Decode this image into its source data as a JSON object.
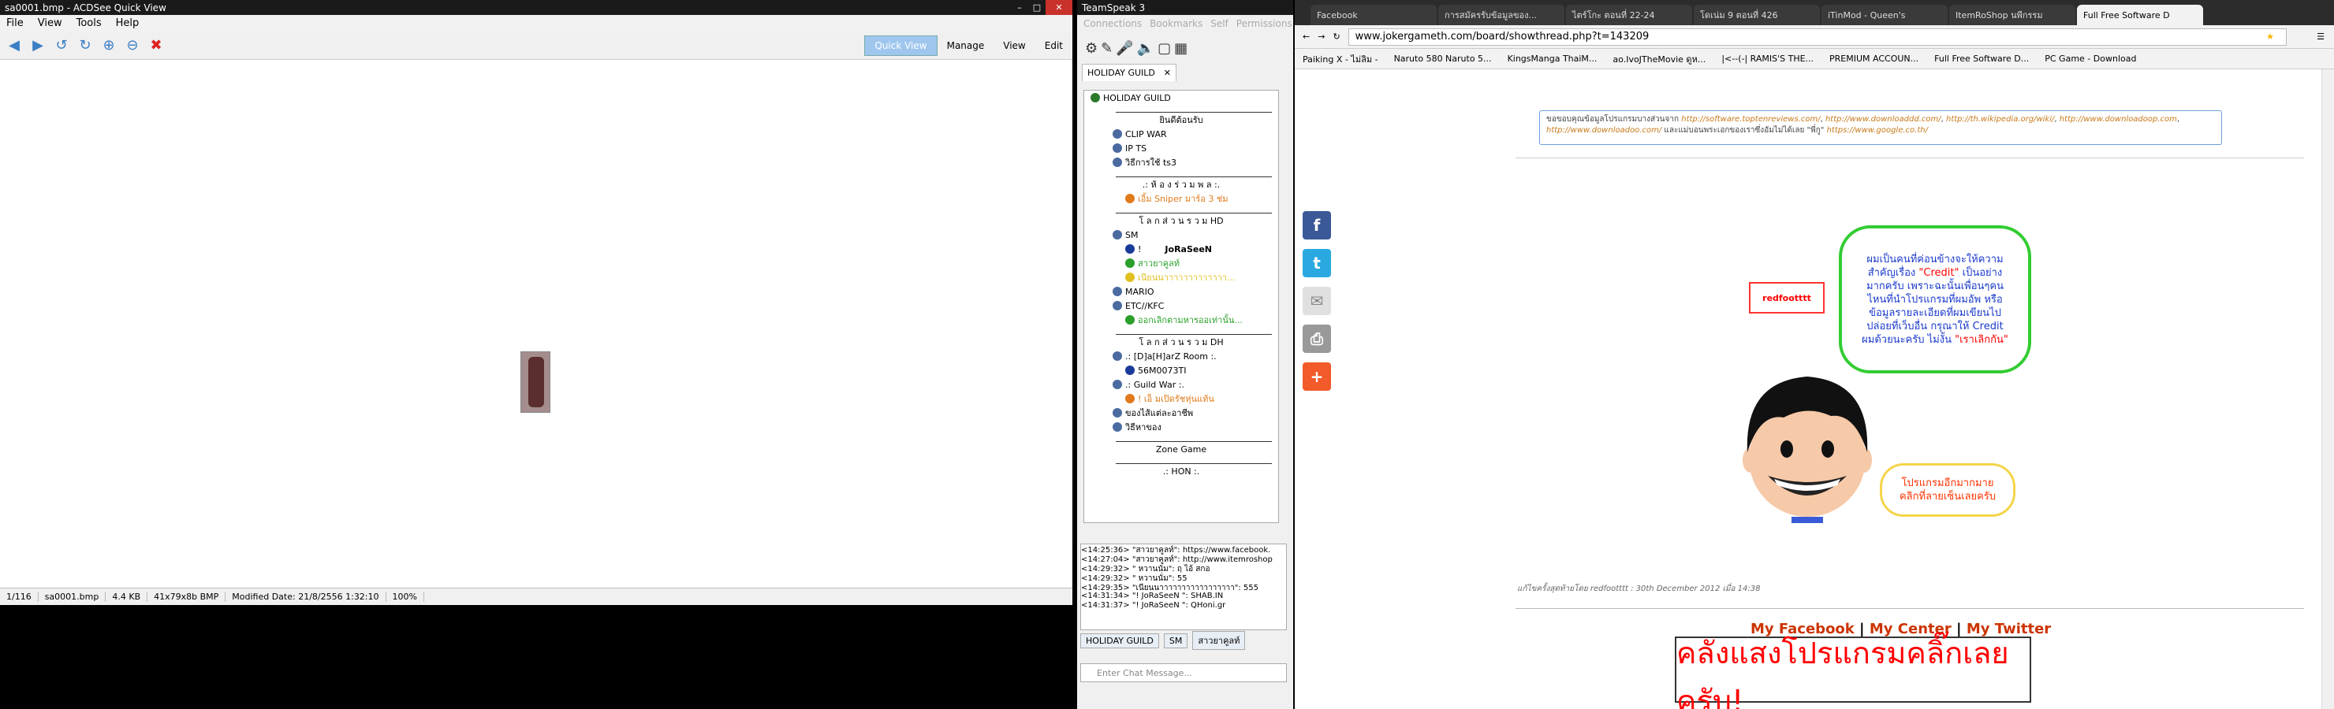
{
  "acdsee": {
    "title": "sa0001.bmp - ACDSee Quick View",
    "menu": [
      "File",
      "View",
      "Tools",
      "Help"
    ],
    "modes": [
      "Quick View",
      "Manage",
      "View",
      "Edit"
    ],
    "status": [
      "1/116",
      "sa0001.bmp",
      "4.4 KB",
      "41x79x8b BMP",
      "Modified Date: 21/8/2556 1:32:10",
      "100%"
    ]
  },
  "teamspeak": {
    "title": "TeamSpeak 3",
    "menu": [
      "Connections",
      "Bookmarks",
      "Self",
      "Permissions"
    ],
    "tab": "HOLIDAY GUILD",
    "tree": [
      {
        "label": "HOLIDAY GUILD",
        "kind": "server"
      },
      {
        "label": "ยินดีต้อนรับ",
        "kind": "center"
      },
      {
        "label": "CLIP WAR",
        "kind": "channel"
      },
      {
        "label": "IP TS",
        "kind": "channel"
      },
      {
        "label": "วิธีการใช้ ts3",
        "kind": "channel"
      },
      {
        "label": ".: ห้ อ ง ร่ ว ม พ ล :.",
        "kind": "center"
      },
      {
        "label": "เอิ้ม Sniper มาร์อ 3 ช่ม",
        "kind": "user-orange"
      },
      {
        "label": "โ ล ก ส่ ว น ร ว ม HD",
        "kind": "center"
      },
      {
        "label": "SM",
        "kind": "channel"
      },
      {
        "label": "!",
        "kind": "user",
        "name": "JoRaSeeN"
      },
      {
        "label": "สาวยาคูลท์",
        "kind": "user-green"
      },
      {
        "label": "เนียนนาาาาาาาาาาาาา...",
        "kind": "user-yellow"
      },
      {
        "label": "MARIO",
        "kind": "channel"
      },
      {
        "label": "ETC//KFC",
        "kind": "channel"
      },
      {
        "label": "ออกเลิกตามหารออเท่านั้น...",
        "kind": "user-green"
      },
      {
        "label": "โ ล ก ส่ ว น ร ว ม DH",
        "kind": "center"
      },
      {
        "label": ".: [D]a[H]arZ Room :.",
        "kind": "channel"
      },
      {
        "label": "56M0073TI",
        "kind": "user"
      },
      {
        "label": ".: Guild War :.",
        "kind": "channel"
      },
      {
        "label": "! เอ็ มเปิดรัชหุ่นแท้น",
        "kind": "user-orange"
      },
      {
        "label": "ของไส้แต่ละอาชีพ",
        "kind": "channel"
      },
      {
        "label": "วิธีหาของ",
        "kind": "channel"
      },
      {
        "label": "Zone Game",
        "kind": "center"
      },
      {
        "label": ".: HON :.",
        "kind": "center"
      }
    ],
    "chatlog": [
      "<14:25:36> \"สาวยาคูลท์\": https://www.facebook.",
      "<14:27:04> \"สาวยาคูลท์\": http://www.itemroshop",
      "<14:29:32> \" หวานนั่ม\": ฤ ไอ้ สกอ",
      "<14:29:32> \" หวานนั่ม\": 55",
      "<14:29:35> \"เนียนนาาาาาาาาาาาาาาาาา\": 555",
      "<14:31:34> \"!  JoRaSeeN  \": SHAB.IN",
      "<14:31:37> \"!  JoRaSeeN  \": QHoni.gr"
    ],
    "chat_tabs": [
      "HOLIDAY GUILD",
      "SM",
      "สาวยาคูลท์"
    ],
    "chat_placeholder": "Enter Chat Message..."
  },
  "chrome": {
    "tabs": [
      "Facebook",
      "การสมัครรับข้อมูลของ...",
      "ไตร์โกะ ตอนที่ 22-24",
      "โดเน่ม 9 ตอนที่ 426",
      "iTinMod - Queen's",
      "ItemRoShop นพีกรรม",
      "Full Free Software D"
    ],
    "url": "www.jokergameth.com/board/showthread.php?t=143209",
    "bookmarks": [
      "Paiking X - ไม่ลิม -",
      "Naruto 580 Naruto 5...",
      "KingsManga ThaiM...",
      "ao.IvoJTheMovie ดูห...",
      "|<--(-| RAMIS'S THE...",
      "PREMIUM ACCOUN...",
      "Full Free Software D...",
      "PC Game - Download"
    ],
    "notice_text": "ขอขอบคุณข้อมูลโปรแกรมบางส่วนจาก",
    "notice_links": [
      "http://software.toptenreviews.com/",
      "http://www.downloaddd.com/",
      "http://th.wikipedia.org/wiki/",
      "http://www.downloadoop.com",
      "http://www.downloadoo.com/"
    ],
    "notice_tail": "และแม่บอนพระเอกของเราซึ่งอัมไม่ได้เลย \"พี่กู\"",
    "notice_google": "https://www.google.co.th/",
    "username": "redfootttt",
    "bubble1": [
      "ผมเป็นคนที่ค่อนข้างจะให้ความ",
      "สำคัญเรื่อง",
      "\"Credit\"",
      "เป็นอย่าง",
      "มากครับ เพราะฉะนั้นเพื่อนๆคน",
      "ไหนที่นำโปรแกรมที่ผมอัพ หรือ",
      "ข้อมูลรายละเอียดที่ผมเขียนไป",
      "ปล่อยที่เว็บอื่น กรุณาให้ Credit",
      "ผมด้วยนะครับ ไม่งั้น",
      "\"เราเลิกกัน\""
    ],
    "bubble2": [
      "โปรแกรมอีกมากมาย",
      "คลิกที่ลายเซ็นเลยครับ"
    ],
    "edited": "แก้ไขครั้งสุดท้ายโดย redfootttt : 30th December 2012 เมื่อ 14:38",
    "links": [
      "My Facebook",
      "My Center",
      "My Twitter"
    ],
    "banner": "คลังแสงโปรแกรมคลิ๊กเลยครับ!"
  }
}
